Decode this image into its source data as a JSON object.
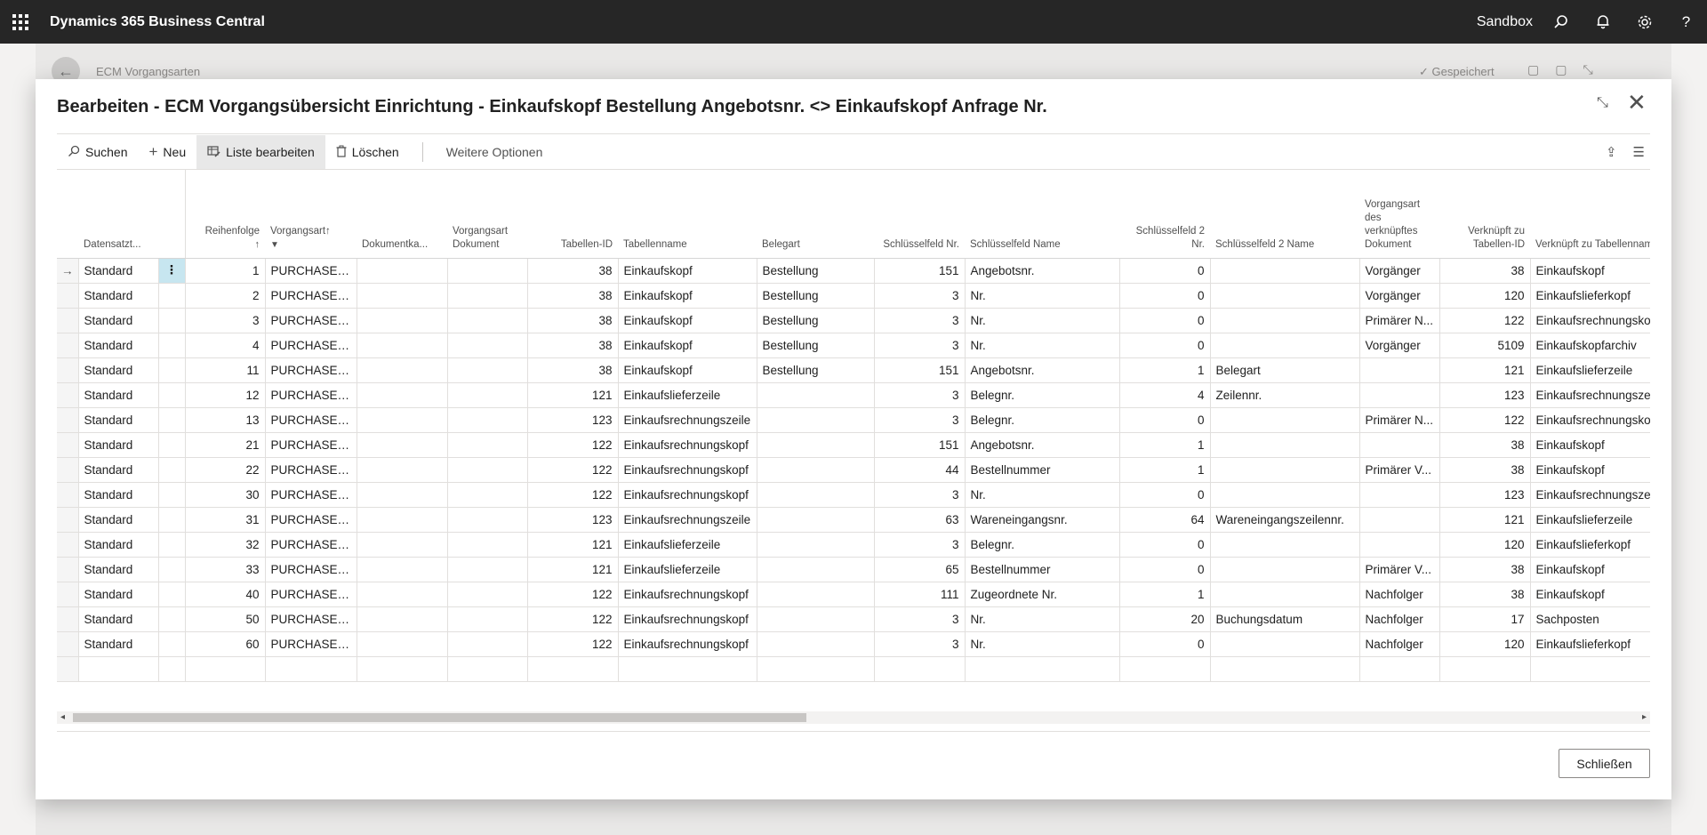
{
  "appbar": {
    "app_name": "Dynamics 365 Business Central",
    "environment": "Sandbox",
    "icons": [
      "search-icon",
      "bell-icon",
      "gear-icon",
      "help-icon"
    ]
  },
  "background_page": {
    "title": "ECM Vorgangsarten",
    "saved_label": "✓ Gespeichert"
  },
  "dialog": {
    "title": "Bearbeiten - ECM Vorgangsübersicht Einrichtung - Einkaufskopf Bestellung Angebotsnr. <> Einkaufskopf Anfrage Nr.",
    "close_button": "Schließen"
  },
  "actions": {
    "search": "Suchen",
    "new": "Neu",
    "edit_list": "Liste bearbeiten",
    "delete": "Löschen",
    "more_options": "Weitere Optionen"
  },
  "columns": [
    "Datensatzt...",
    "Reihenfolge",
    "Vorgangsart",
    "Dokumentka...",
    "Vorgangsart Dokument",
    "Tabellen-ID",
    "Tabellenname",
    "Belegart",
    "Schlüsselfeld Nr.",
    "Schlüsselfeld Name",
    "Schlüsselfeld 2 Nr.",
    "Schlüsselfeld 2 Name",
    "Vorgangsart des verknüpftes Dokument",
    "Verknüpft zu Tabellen-ID",
    "Verknüpft zu Tabellenname"
  ],
  "rows": [
    {
      "typ": "Standard",
      "seq": "1",
      "art": "PURCHASE I...",
      "tid": "38",
      "tname": "Einkaufskopf",
      "beleg": "Bestellung",
      "k1": "151",
      "k1n": "Angebotsnr.",
      "k2": "0",
      "k2n": "",
      "lart": "Vorgänger",
      "ltid": "38",
      "ltname": "Einkaufskopf"
    },
    {
      "typ": "Standard",
      "seq": "2",
      "art": "PURCHASE I...",
      "tid": "38",
      "tname": "Einkaufskopf",
      "beleg": "Bestellung",
      "k1": "3",
      "k1n": "Nr.",
      "k2": "0",
      "k2n": "",
      "lart": "Vorgänger",
      "ltid": "120",
      "ltname": "Einkaufslieferkopf"
    },
    {
      "typ": "Standard",
      "seq": "3",
      "art": "PURCHASE I...",
      "tid": "38",
      "tname": "Einkaufskopf",
      "beleg": "Bestellung",
      "k1": "3",
      "k1n": "Nr.",
      "k2": "0",
      "k2n": "",
      "lart": "Primärer N...",
      "ltid": "122",
      "ltname": "Einkaufsrechnungsko"
    },
    {
      "typ": "Standard",
      "seq": "4",
      "art": "PURCHASE I...",
      "tid": "38",
      "tname": "Einkaufskopf",
      "beleg": "Bestellung",
      "k1": "3",
      "k1n": "Nr.",
      "k2": "0",
      "k2n": "",
      "lart": "Vorgänger",
      "ltid": "5109",
      "ltname": "Einkaufskopfarchiv"
    },
    {
      "typ": "Standard",
      "seq": "11",
      "art": "PURCHASE I...",
      "tid": "38",
      "tname": "Einkaufskopf",
      "beleg": "Bestellung",
      "k1": "151",
      "k1n": "Angebotsnr.",
      "k2": "1",
      "k2n": "Belegart",
      "lart": "",
      "ltid": "121",
      "ltname": "Einkaufslieferzeile"
    },
    {
      "typ": "Standard",
      "seq": "12",
      "art": "PURCHASE I...",
      "tid": "121",
      "tname": "Einkaufslieferzeile",
      "beleg": "",
      "k1": "3",
      "k1n": "Belegnr.",
      "k2": "4",
      "k2n": "Zeilennr.",
      "lart": "",
      "ltid": "123",
      "ltname": "Einkaufsrechnungsze"
    },
    {
      "typ": "Standard",
      "seq": "13",
      "art": "PURCHASE I...",
      "tid": "123",
      "tname": "Einkaufsrechnungszeile",
      "beleg": "",
      "k1": "3",
      "k1n": "Belegnr.",
      "k2": "0",
      "k2n": "",
      "lart": "Primärer N...",
      "ltid": "122",
      "ltname": "Einkaufsrechnungsko"
    },
    {
      "typ": "Standard",
      "seq": "21",
      "art": "PURCHASE I...",
      "tid": "122",
      "tname": "Einkaufsrechnungskopf",
      "beleg": "",
      "k1": "151",
      "k1n": "Angebotsnr.",
      "k2": "1",
      "k2n": "",
      "lart": "",
      "ltid": "38",
      "ltname": "Einkaufskopf"
    },
    {
      "typ": "Standard",
      "seq": "22",
      "art": "PURCHASE I...",
      "tid": "122",
      "tname": "Einkaufsrechnungskopf",
      "beleg": "",
      "k1": "44",
      "k1n": "Bestellnummer",
      "k2": "1",
      "k2n": "",
      "lart": "Primärer V...",
      "ltid": "38",
      "ltname": "Einkaufskopf"
    },
    {
      "typ": "Standard",
      "seq": "30",
      "art": "PURCHASE I...",
      "tid": "122",
      "tname": "Einkaufsrechnungskopf",
      "beleg": "",
      "k1": "3",
      "k1n": "Nr.",
      "k2": "0",
      "k2n": "",
      "lart": "",
      "ltid": "123",
      "ltname": "Einkaufsrechnungsze"
    },
    {
      "typ": "Standard",
      "seq": "31",
      "art": "PURCHASE I...",
      "tid": "123",
      "tname": "Einkaufsrechnungszeile",
      "beleg": "",
      "k1": "63",
      "k1n": "Wareneingangsnr.",
      "k2": "64",
      "k2n": "Wareneingangszeilennr.",
      "lart": "",
      "ltid": "121",
      "ltname": "Einkaufslieferzeile"
    },
    {
      "typ": "Standard",
      "seq": "32",
      "art": "PURCHASE I...",
      "tid": "121",
      "tname": "Einkaufslieferzeile",
      "beleg": "",
      "k1": "3",
      "k1n": "Belegnr.",
      "k2": "0",
      "k2n": "",
      "lart": "",
      "ltid": "120",
      "ltname": "Einkaufslieferkopf"
    },
    {
      "typ": "Standard",
      "seq": "33",
      "art": "PURCHASE I...",
      "tid": "121",
      "tname": "Einkaufslieferzeile",
      "beleg": "",
      "k1": "65",
      "k1n": "Bestellnummer",
      "k2": "0",
      "k2n": "",
      "lart": "Primärer V...",
      "ltid": "38",
      "ltname": "Einkaufskopf"
    },
    {
      "typ": "Standard",
      "seq": "40",
      "art": "PURCHASE I...",
      "tid": "122",
      "tname": "Einkaufsrechnungskopf",
      "beleg": "",
      "k1": "111",
      "k1n": "Zugeordnete Nr.",
      "k2": "1",
      "k2n": "",
      "lart": "Nachfolger",
      "ltid": "38",
      "ltname": "Einkaufskopf"
    },
    {
      "typ": "Standard",
      "seq": "50",
      "art": "PURCHASE I...",
      "tid": "122",
      "tname": "Einkaufsrechnungskopf",
      "beleg": "",
      "k1": "3",
      "k1n": "Nr.",
      "k2": "20",
      "k2n": "Buchungsdatum",
      "lart": "Nachfolger",
      "ltid": "17",
      "ltname": "Sachposten"
    },
    {
      "typ": "Standard",
      "seq": "60",
      "art": "PURCHASE I...",
      "tid": "122",
      "tname": "Einkaufsrechnungskopf",
      "beleg": "",
      "k1": "3",
      "k1n": "Nr.",
      "k2": "0",
      "k2n": "",
      "lart": "Nachfolger",
      "ltid": "120",
      "ltname": "Einkaufslieferkopf"
    }
  ]
}
